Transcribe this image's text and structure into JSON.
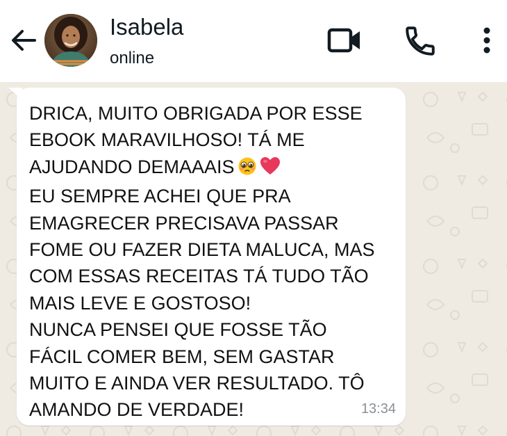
{
  "header": {
    "contact_name": "Isabela",
    "status": "online",
    "icons": [
      "back-arrow-icon",
      "video-camera-icon",
      "phone-icon",
      "more-vert-icon"
    ]
  },
  "message": {
    "line1": "DRICA, MUITO OBRIGADA POR ESSE\nEBOOK MARAVILHOSO! TÁ ME\nAJUDANDO DEMAAAIS",
    "line2": "EU SEMPRE ACHEI QUE PRA\nEMAGRECER PRECISAVA PASSAR\nFOME OU FAZER DIETA MALUCA, MAS\nCOM ESSAS RECEITAS TÁ TUDO TÃO\nMAIS LEVE E GOSTOSO!\nNUNCA PENSEI QUE FOSSE TÃO\nFÁCIL COMER BEM, SEM GASTAR\nMUITO E AINDA VER RESULTADO. TÔ\nAMANDO DE VERDADE!",
    "time": "13:34",
    "emojis": [
      "pleading-face-emoji",
      "heart-emoji"
    ]
  },
  "colors": {
    "header_bg": "#ffffff",
    "chat_bg": "#efeae2",
    "bubble_bg": "#ffffff",
    "text": "#111b21",
    "timestamp": "#8a9094",
    "heart": "#e8385b"
  }
}
